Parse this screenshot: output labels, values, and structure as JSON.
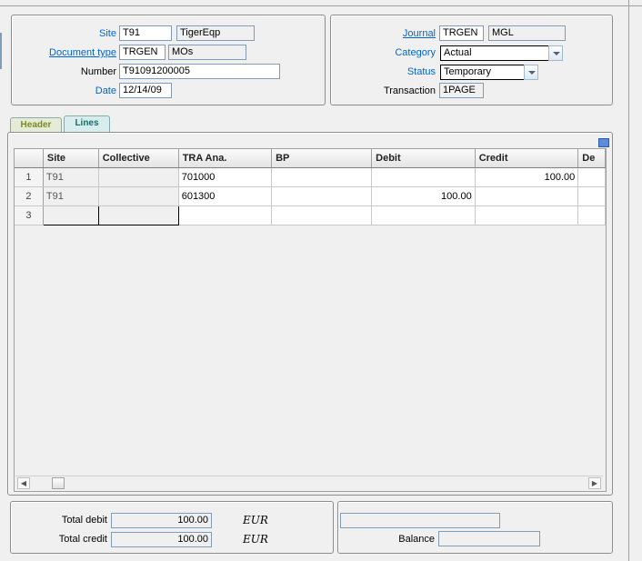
{
  "header": {
    "site": {
      "label": "Site",
      "code": "T91",
      "desc": "TigerEqp"
    },
    "doc_type": {
      "label": "Document type",
      "code": "TRGEN",
      "desc": "MOs"
    },
    "number": {
      "label": "Number",
      "value": "T91091200005"
    },
    "date": {
      "label": "Date",
      "value": "12/14/09"
    },
    "journal": {
      "label": "Journal",
      "code": "TRGEN",
      "desc": "MGL"
    },
    "category": {
      "label": "Category",
      "value": "Actual"
    },
    "status": {
      "label": "Status",
      "value": "Temporary"
    },
    "transaction": {
      "label": "Transaction",
      "value": "1PAGE"
    }
  },
  "tabs": [
    {
      "label": "Header"
    },
    {
      "label": "Lines"
    }
  ],
  "grid": {
    "columns": [
      "Site",
      "Collective",
      "TRA Ana.",
      "BP",
      "Debit",
      "Credit",
      "De"
    ],
    "rows": [
      {
        "n": "1",
        "site": "T91",
        "collective": "",
        "tra": "701000",
        "bp": "",
        "debit": "",
        "credit": "100.00"
      },
      {
        "n": "2",
        "site": "T91",
        "collective": "",
        "tra": "601300",
        "bp": "",
        "debit": "100.00",
        "credit": ""
      },
      {
        "n": "3",
        "site": "",
        "collective": "",
        "tra": "",
        "bp": "",
        "debit": "",
        "credit": ""
      }
    ]
  },
  "totals": {
    "total_debit": {
      "label": "Total debit",
      "value": "100.00",
      "currency": "EUR"
    },
    "total_credit": {
      "label": "Total credit",
      "value": "100.00",
      "currency": "EUR"
    },
    "balance": {
      "label": "Balance",
      "value": ""
    },
    "extra": ""
  },
  "colors": {
    "link": "#0066cc",
    "field_border": "#7f9db9"
  }
}
